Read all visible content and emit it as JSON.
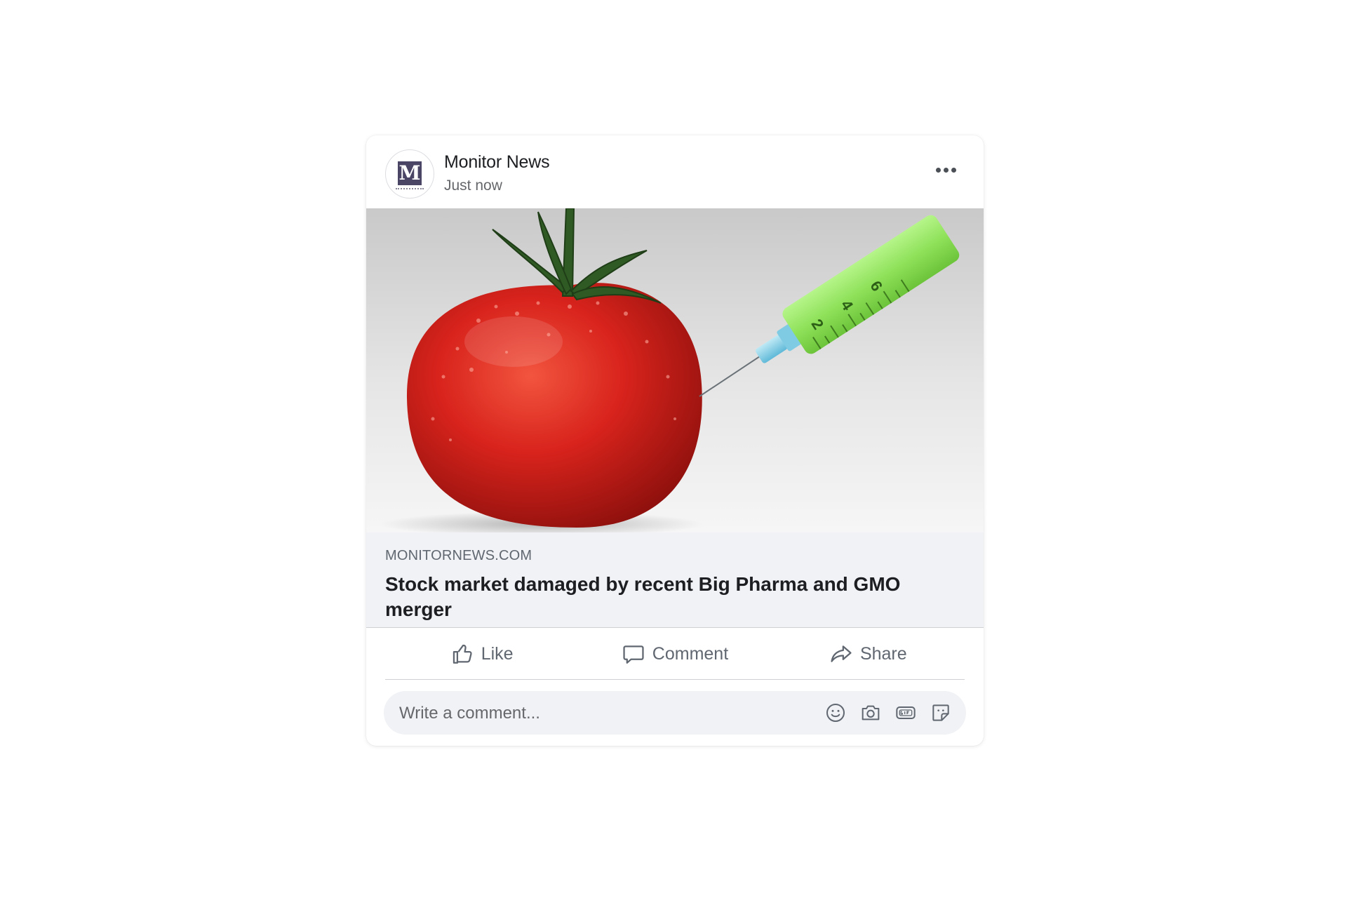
{
  "post": {
    "page_name": "Monitor News",
    "time": "Just now",
    "avatar_letter": "M"
  },
  "link_preview": {
    "domain": "MONITORNEWS.COM",
    "title": "Stock market damaged by recent Big Pharma and GMO merger"
  },
  "actions": {
    "like_label": "Like",
    "comment_label": "Comment",
    "share_label": "Share"
  },
  "comment_box": {
    "placeholder": "Write a comment..."
  },
  "syringe_scale": [
    "2",
    "4",
    "6"
  ],
  "colors": {
    "text_primary": "#1c1e21",
    "text_secondary": "#65676b",
    "surface": "#f0f2f5",
    "tomato_red": "#d8231c",
    "syringe_green": "#8fe15a"
  }
}
